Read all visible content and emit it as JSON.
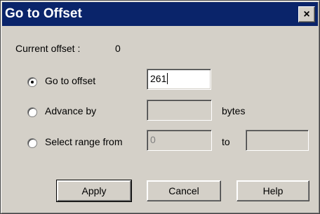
{
  "window": {
    "title": "Go to Offset",
    "close_glyph": "×",
    "icon": "close-icon"
  },
  "current_offset": {
    "label": "Current offset :",
    "value": "0"
  },
  "options": [
    {
      "label": "Go to offset",
      "selected": true,
      "value": "261"
    },
    {
      "label": "Advance by",
      "selected": false,
      "value": "",
      "unit": "bytes"
    },
    {
      "label": "Select range from",
      "selected": false,
      "from_value": "0",
      "to_label": "to",
      "to_value": ""
    }
  ],
  "buttons": {
    "apply": "Apply",
    "cancel": "Cancel",
    "help": "Help"
  },
  "colors": {
    "titlebar": "#0a246a",
    "face": "#d4d0c8"
  }
}
